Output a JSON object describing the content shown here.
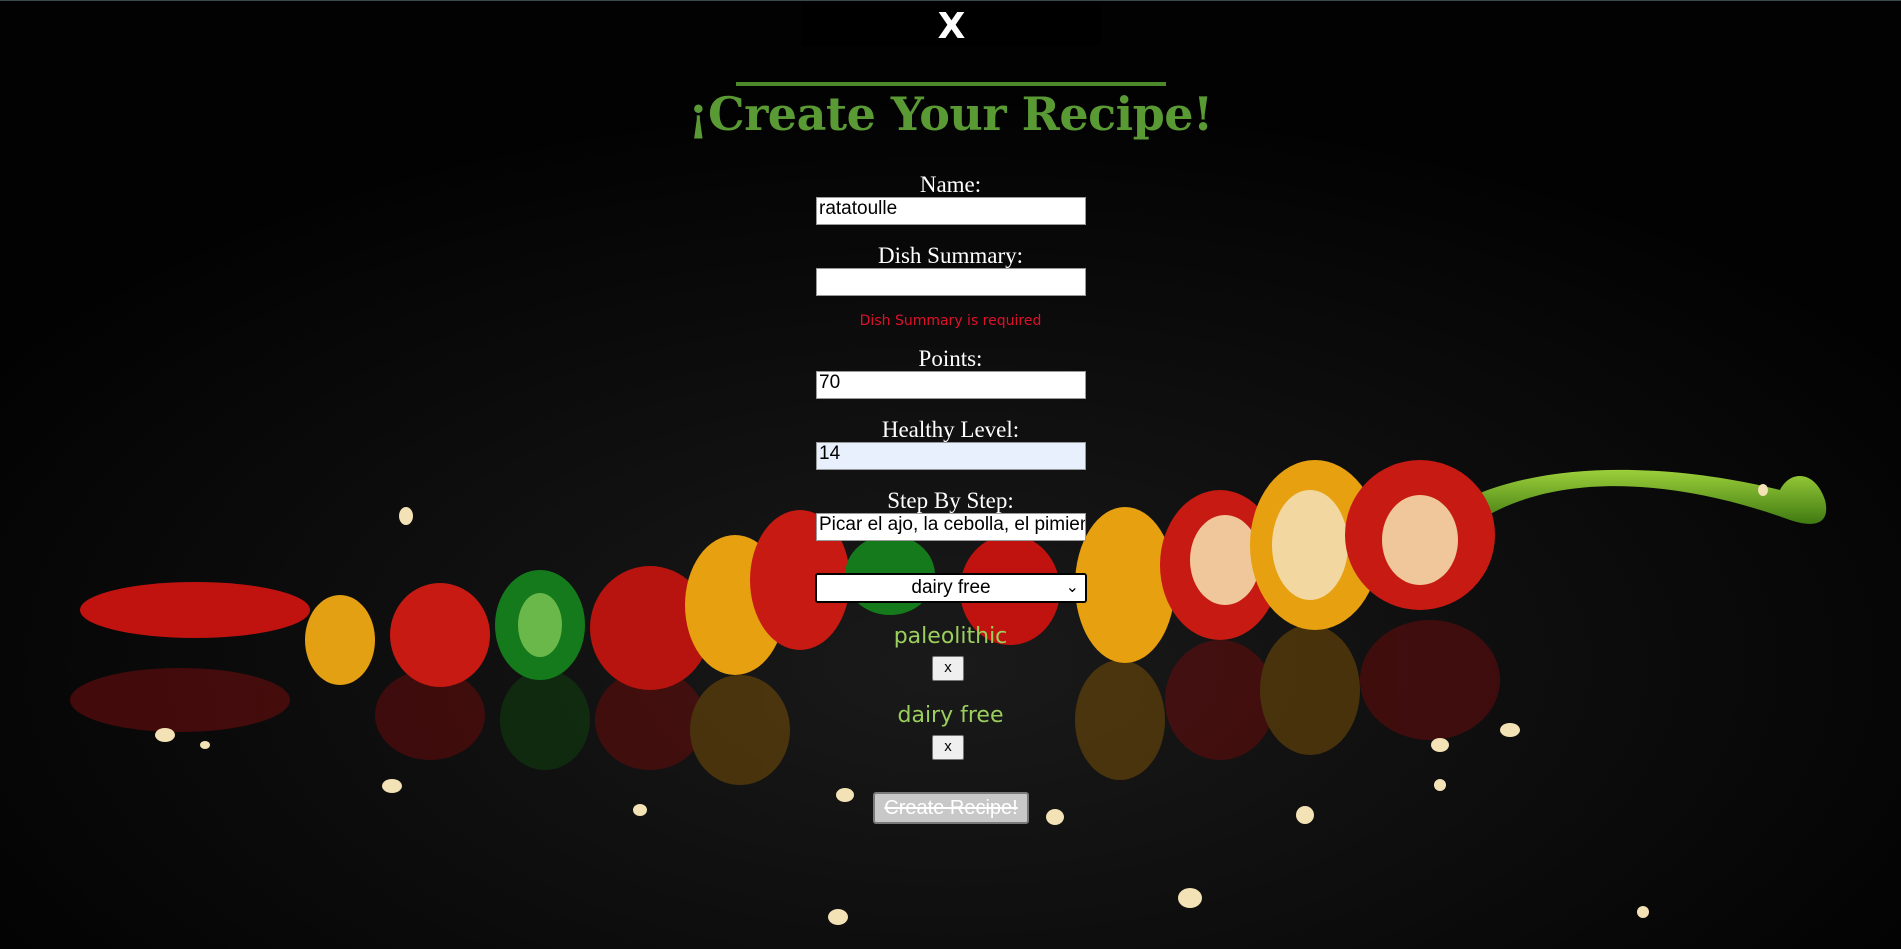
{
  "close_button": {
    "label": "X"
  },
  "form": {
    "title": "¡Create Your Recipe!",
    "fields": {
      "name": {
        "label": "Name:",
        "value": "ratatoulle"
      },
      "summary": {
        "label": "Dish Summary:",
        "value": "",
        "error": "Dish Summary is required"
      },
      "points": {
        "label": "Points:",
        "value": "70"
      },
      "healthy_level": {
        "label": "Healthy Level:",
        "value": "14"
      },
      "steps": {
        "label": "Step By Step:",
        "value": "Picar el ajo, la cebolla, el pimiento"
      }
    },
    "diet_select": {
      "selected": "dairy free"
    },
    "diets": [
      {
        "name": "paleolithic",
        "remove_label": "x"
      },
      {
        "name": "dairy free",
        "remove_label": "x"
      }
    ],
    "submit_label": "Create Recipe!"
  },
  "colors": {
    "title": "#5a9a34",
    "tag": "#9bcf5d",
    "error": "#e0102a"
  }
}
